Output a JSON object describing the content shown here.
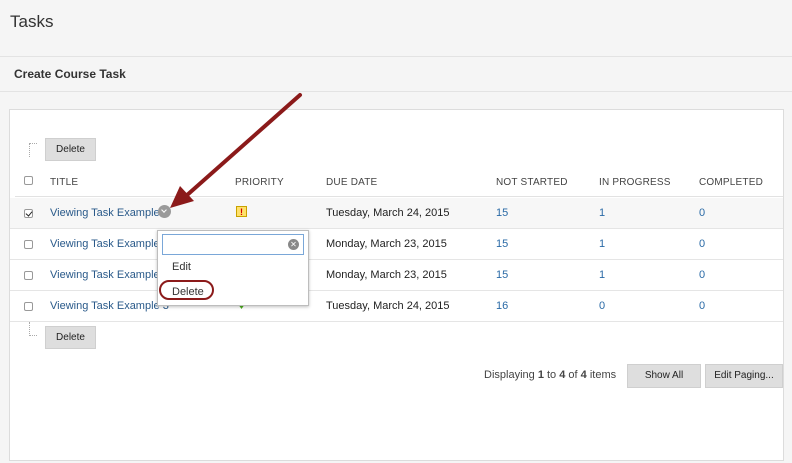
{
  "page": {
    "title": "Tasks"
  },
  "action_bar": {
    "create_label": "Create Course Task"
  },
  "toolbar": {
    "delete_top": "Delete",
    "delete_bottom": "Delete"
  },
  "table": {
    "headers": [
      "TITLE",
      "PRIORITY",
      "DUE DATE",
      "NOT STARTED",
      "IN PROGRESS",
      "COMPLETED"
    ],
    "rows": [
      {
        "title": "Viewing Task Example",
        "priority": "high",
        "due": "Tuesday, March 24, 2015",
        "not_started": "15",
        "in_progress": "1",
        "completed": "0",
        "checked": true
      },
      {
        "title": "Viewing Task Example",
        "priority": "",
        "due": "Monday, March 23, 2015",
        "not_started": "15",
        "in_progress": "1",
        "completed": "0",
        "checked": false
      },
      {
        "title": "Viewing Task Example",
        "priority": "",
        "due": "Monday, March 23, 2015",
        "not_started": "15",
        "in_progress": "1",
        "completed": "0",
        "checked": false
      },
      {
        "title": "Viewing Task Example 3",
        "priority": "low",
        "due": "Tuesday, March 24, 2015",
        "not_started": "16",
        "in_progress": "0",
        "completed": "0",
        "checked": false
      }
    ]
  },
  "context_menu": {
    "search_value": "",
    "items": [
      "Edit",
      "Delete"
    ]
  },
  "paging": {
    "displaying_prefix": "Displaying ",
    "from": "1",
    "to_word": " to ",
    "to": "4",
    "of_word": " of ",
    "total": "4",
    "items_word": " items",
    "show_all": "Show All",
    "edit_paging": "Edit Paging..."
  },
  "colors": {
    "annotation_arrow": "#8b1a1a",
    "link": "#2a5a8a"
  }
}
